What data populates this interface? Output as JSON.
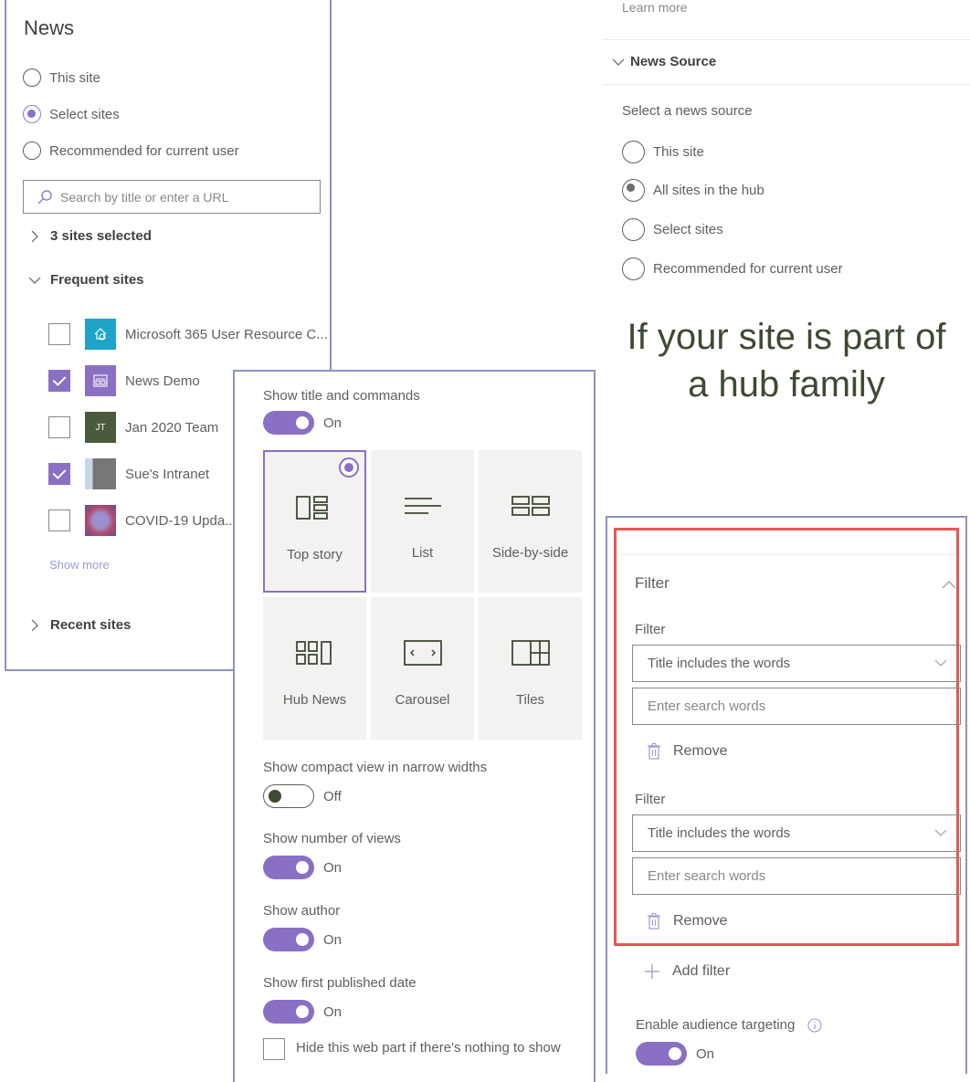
{
  "left_panel": {
    "title": "News",
    "radios": [
      {
        "label": "This site",
        "selected": false
      },
      {
        "label": "Select sites",
        "selected": true
      },
      {
        "label": "Recommended for current user",
        "selected": false
      }
    ],
    "search": {
      "placeholder": "Search by title or enter a URL",
      "value": ""
    },
    "selected_summary": "3 sites selected",
    "frequent_sites_label": "Frequent sites",
    "frequent_sites": [
      {
        "name": "Microsoft 365 User Resource C...",
        "checked": false,
        "thumb_color": "#1fa3c9",
        "thumb_text": ""
      },
      {
        "name": "News Demo",
        "checked": true,
        "thumb_color": "#8a70c4",
        "thumb_text": ""
      },
      {
        "name": "Jan 2020 Team",
        "checked": false,
        "thumb_color": "#4b5a3c",
        "thumb_text": "JT"
      },
      {
        "name": "Sue's Intranet",
        "checked": true,
        "thumb_color": "#9aa0a8",
        "thumb_text": ""
      },
      {
        "name": "COVID-19 Upda...",
        "checked": false,
        "thumb_color": "#8a5a9c",
        "thumb_text": ""
      }
    ],
    "show_more": "Show more",
    "recent_sites_label": "Recent sites"
  },
  "middle_panel": {
    "show_title_label": "Show title and commands",
    "show_title_state": "On",
    "layouts": [
      {
        "label": "Top story",
        "icon": "top-story-layout-icon",
        "selected": true
      },
      {
        "label": "List",
        "icon": "list-layout-icon",
        "selected": false
      },
      {
        "label": "Side-by-side",
        "icon": "side-by-side-layout-icon",
        "selected": false
      },
      {
        "label": "Hub News",
        "icon": "hub-news-layout-icon",
        "selected": false
      },
      {
        "label": "Carousel",
        "icon": "carousel-layout-icon",
        "selected": false
      },
      {
        "label": "Tiles",
        "icon": "tiles-layout-icon",
        "selected": false
      }
    ],
    "compact_label": "Show compact view in narrow widths",
    "compact_state": "Off",
    "views_label": "Show number of views",
    "views_state": "On",
    "author_label": "Show author",
    "author_state": "On",
    "date_label": "Show first published date",
    "date_state": "On",
    "hide_label": "Hide this web part if there's nothing to show",
    "hide_checked": false
  },
  "right_top": {
    "learn_more": "Learn more",
    "section_title": "News Source",
    "prompt": "Select a news source",
    "radios": [
      {
        "label": "This site",
        "selected": false
      },
      {
        "label": "All sites in the hub",
        "selected": true
      },
      {
        "label": "Select sites",
        "selected": false
      },
      {
        "label": "Recommended for current user",
        "selected": false
      }
    ]
  },
  "headline": {
    "line1": "If your site is part of",
    "line2": "a hub family"
  },
  "right_bottom": {
    "section_title": "Filter",
    "filters": [
      {
        "label": "Filter",
        "type_value": "Title includes the words",
        "search_placeholder": "Enter search words",
        "remove_label": "Remove"
      },
      {
        "label": "Filter",
        "type_value": "Title includes the words",
        "search_placeholder": "Enter search words",
        "remove_label": "Remove"
      }
    ],
    "add_filter": "Add filter",
    "audience_label": "Enable audience targeting",
    "audience_state": "On"
  },
  "colors": {
    "accent": "#8a70c4",
    "highlight_border": "#e05a52",
    "panel_border": "#8c93c0"
  }
}
